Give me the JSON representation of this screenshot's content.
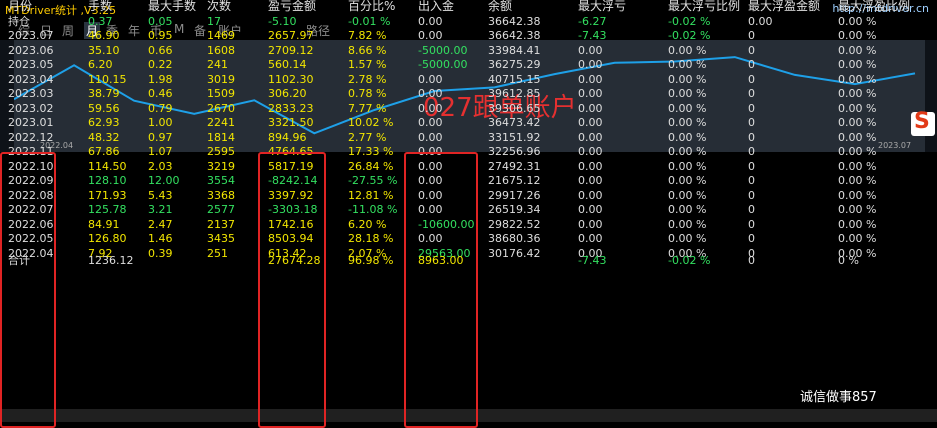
{
  "app_title": "MTDriver统计 ,V3.25",
  "site_url": "http://mtdriver.cn",
  "tabs": [
    "综",
    "日",
    "周",
    "月",
    "季",
    "年",
    "币",
    "M",
    "备",
    "账户",
    "路径"
  ],
  "active_tab": "月",
  "chart_annotation": "027跟单账户",
  "chart_x_start": "2022.04",
  "chart_x_end": "2023.07",
  "badge_letter": "S",
  "watermark": "诚信做事857",
  "colors": {
    "yellow": "#f2e600",
    "green": "#33e060",
    "line": "#1ea0e8",
    "box": "#e02424"
  },
  "headers": [
    "月份",
    "手数",
    "最大手数",
    "次数",
    "盈亏金额",
    "百分比%",
    "出入金",
    "余额",
    "最大浮亏",
    "最大浮亏比例",
    "最大浮盈金额",
    "最大浮盈比例"
  ],
  "holding": {
    "label": "持仓",
    "lots": "0.37",
    "maxlots": "0.05",
    "count": "17",
    "pnl": "-5.10",
    "pct": "-0.01 %",
    "flow": "0.00",
    "bal": "36642.38",
    "dd": "-6.27",
    "ddp": "-0.02 %",
    "fu": "0.00",
    "fup": "0.00 %"
  },
  "rows": [
    {
      "m": "2023.07",
      "lots": "46.90",
      "maxlots": "0.95",
      "count": "1469",
      "pnl": "2657.97",
      "pct": "7.82 %",
      "flow": "0.00",
      "bal": "36642.38",
      "dd": "-7.43",
      "ddp": "-0.02 %",
      "fu": "0",
      "fup": "0.00 %"
    },
    {
      "m": "2023.06",
      "lots": "35.10",
      "maxlots": "0.66",
      "count": "1608",
      "pnl": "2709.12",
      "pct": "8.66 %",
      "flow": "-5000.00",
      "bal": "33984.41",
      "dd": "0.00",
      "ddp": "0.00 %",
      "fu": "0",
      "fup": "0.00 %"
    },
    {
      "m": "2023.05",
      "lots": "6.20",
      "maxlots": "0.22",
      "count": "241",
      "pnl": "560.14",
      "pct": "1.57 %",
      "flow": "-5000.00",
      "bal": "36275.29",
      "dd": "0.00",
      "ddp": "0.00 %",
      "fu": "0",
      "fup": "0.00 %"
    },
    {
      "m": "2023.04",
      "lots": "110.15",
      "maxlots": "1.98",
      "count": "3019",
      "pnl": "1102.30",
      "pct": "2.78 %",
      "flow": "0.00",
      "bal": "40715.15",
      "dd": "0.00",
      "ddp": "0.00 %",
      "fu": "0",
      "fup": "0.00 %"
    },
    {
      "m": "2023.03",
      "lots": "38.79",
      "maxlots": "0.46",
      "count": "1509",
      "pnl": "306.20",
      "pct": "0.78 %",
      "flow": "0.00",
      "bal": "39612.85",
      "dd": "0.00",
      "ddp": "0.00 %",
      "fu": "0",
      "fup": "0.00 %"
    },
    {
      "m": "2023.02",
      "lots": "59.56",
      "maxlots": "0.79",
      "count": "2670",
      "pnl": "2833.23",
      "pct": "7.77 %",
      "flow": "0.00",
      "bal": "39306.65",
      "dd": "0.00",
      "ddp": "0.00 %",
      "fu": "0",
      "fup": "0.00 %"
    },
    {
      "m": "2023.01",
      "lots": "62.93",
      "maxlots": "1.00",
      "count": "2241",
      "pnl": "3321.50",
      "pct": "10.02 %",
      "flow": "0.00",
      "bal": "36473.42",
      "dd": "0.00",
      "ddp": "0.00 %",
      "fu": "0",
      "fup": "0.00 %"
    },
    {
      "m": "2022.12",
      "lots": "48.32",
      "maxlots": "0.97",
      "count": "1814",
      "pnl": "894.96",
      "pct": "2.77 %",
      "flow": "0.00",
      "bal": "33151.92",
      "dd": "0.00",
      "ddp": "0.00 %",
      "fu": "0",
      "fup": "0.00 %"
    },
    {
      "m": "2022.11",
      "lots": "67.86",
      "maxlots": "1.07",
      "count": "2595",
      "pnl": "4764.65",
      "pct": "17.33 %",
      "flow": "0.00",
      "bal": "32256.96",
      "dd": "0.00",
      "ddp": "0.00 %",
      "fu": "0",
      "fup": "0.00 %"
    },
    {
      "m": "2022.10",
      "lots": "114.50",
      "maxlots": "2.03",
      "count": "3219",
      "pnl": "5817.19",
      "pct": "26.84 %",
      "flow": "0.00",
      "bal": "27492.31",
      "dd": "0.00",
      "ddp": "0.00 %",
      "fu": "0",
      "fup": "0.00 %"
    },
    {
      "m": "2022.09",
      "lots": "128.10",
      "maxlots": "12.00",
      "count": "3554",
      "pnl": "-8242.14",
      "pct": "-27.55 %",
      "flow": "0.00",
      "bal": "21675.12",
      "dd": "0.00",
      "ddp": "0.00 %",
      "fu": "0",
      "fup": "0.00 %"
    },
    {
      "m": "2022.08",
      "lots": "171.93",
      "maxlots": "5.43",
      "count": "3368",
      "pnl": "3397.92",
      "pct": "12.81 %",
      "flow": "0.00",
      "bal": "29917.26",
      "dd": "0.00",
      "ddp": "0.00 %",
      "fu": "0",
      "fup": "0.00 %"
    },
    {
      "m": "2022.07",
      "lots": "125.78",
      "maxlots": "3.21",
      "count": "2577",
      "pnl": "-3303.18",
      "pct": "-11.08 %",
      "flow": "0.00",
      "bal": "26519.34",
      "dd": "0.00",
      "ddp": "0.00 %",
      "fu": "0",
      "fup": "0.00 %"
    },
    {
      "m": "2022.06",
      "lots": "84.91",
      "maxlots": "2.47",
      "count": "2137",
      "pnl": "1742.16",
      "pct": "6.20 %",
      "flow": "-10600.00",
      "bal": "29822.52",
      "dd": "0.00",
      "ddp": "0.00 %",
      "fu": "0",
      "fup": "0.00 %"
    },
    {
      "m": "2022.05",
      "lots": "126.80",
      "maxlots": "1.46",
      "count": "3435",
      "pnl": "8503.94",
      "pct": "28.18 %",
      "flow": "0.00",
      "bal": "38680.36",
      "dd": "0.00",
      "ddp": "0.00 %",
      "fu": "0",
      "fup": "0.00 %"
    },
    {
      "m": "2022.04",
      "lots": "7.92",
      "maxlots": "0.39",
      "count": "251",
      "pnl": "613.42",
      "pct": "2.07 %",
      "flow": "29563.00",
      "bal": "30176.42",
      "dd": "0.00",
      "ddp": "0.00 %",
      "fu": "0",
      "fup": "0.00 %"
    }
  ],
  "total": {
    "label": "合计",
    "lots": "1236.12",
    "pnl": "27674.28",
    "pct": "96.98 %",
    "flow": "8963.00",
    "dd": "-7.43",
    "ddp": "-0.02 %",
    "fu": "0",
    "fup": "0 %"
  },
  "balance_curve": [
    30176.42,
    38680.36,
    29822.52,
    26519.34,
    29917.26,
    21675.12,
    27492.31,
    32256.96,
    33151.92,
    36473.42,
    39306.65,
    39612.85,
    40715.15,
    36275.29,
    33984.41,
    36642.38
  ]
}
